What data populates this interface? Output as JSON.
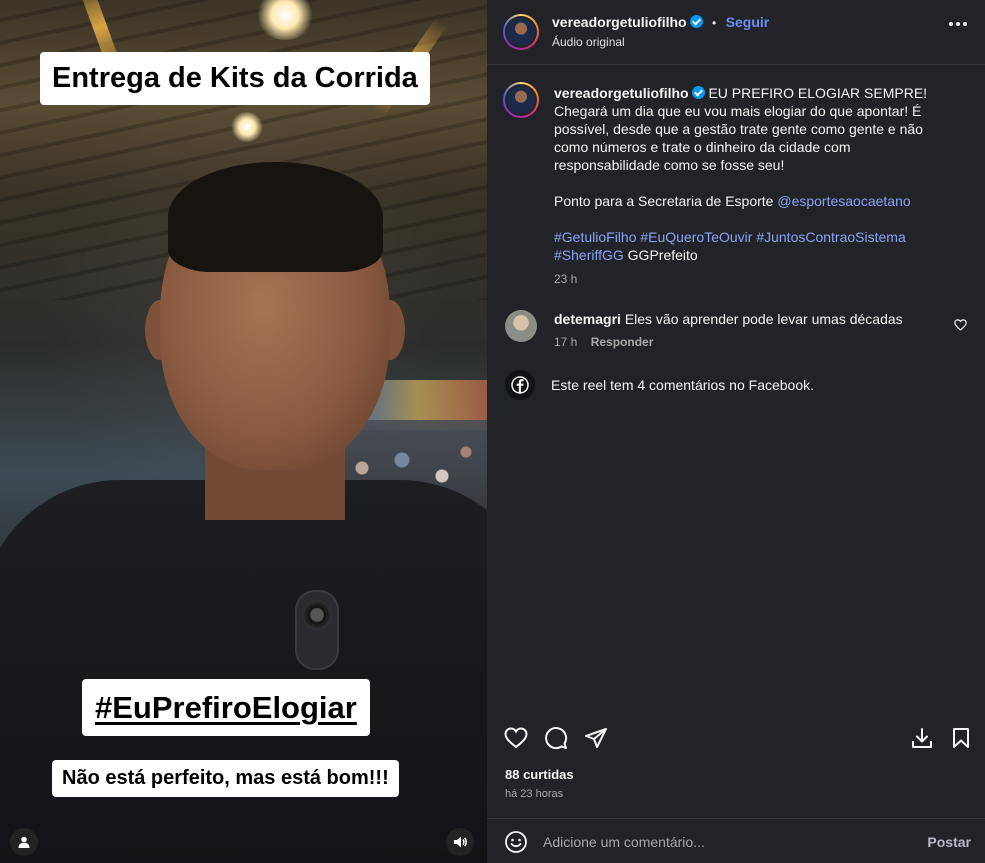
{
  "video": {
    "overlay_title": "Entrega de Kits da Corrida",
    "overlay_hashtag": "#EuPrefiroElogiar",
    "overlay_subtitle": "Não está perfeito, mas está bom!!!",
    "user_icon": "user-icon",
    "audio_icon": "speaker-icon"
  },
  "header": {
    "username": "vereadorgetuliofilho",
    "separator": "•",
    "follow_label": "Seguir",
    "audio_label": "Áudio original",
    "more_icon": "more-options-icon"
  },
  "caption": {
    "username": "vereadorgetuliofilho",
    "text": "EU PREFIRO ELOGIAR SEMPRE! Chegará um dia que eu vou mais elogiar do que apontar! É possível, desde que a gestão trate gente como gente e não como números e trate o dinheiro da cidade com responsabilidade como se fosse seu!",
    "line2_prefix": "Ponto para a Secretaria de Esporte ",
    "line2_mention": "@esportesaocaetano",
    "hashtags": "#GetulioFilho #EuQueroTeOuvir #JuntosContraoSistema #SheriffGG",
    "trailing": " GGPrefeito",
    "time": "23 h"
  },
  "comment": {
    "username": "detemagri",
    "text": "Eles vão aprender pode levar umas décadas",
    "time": "17 h",
    "reply_label": "Responder"
  },
  "facebook_note": "Este reel tem 4 comentários no Facebook.",
  "actions": {
    "likes": "88 curtidas",
    "posted": "há 23 horas"
  },
  "comment_input": {
    "placeholder": "Adicione um comentário...",
    "post_label": "Postar"
  },
  "colors": {
    "panel_bg": "#212328",
    "link": "#8aa4f5",
    "follow": "#6c8ef5",
    "verified": "#0095f6"
  }
}
